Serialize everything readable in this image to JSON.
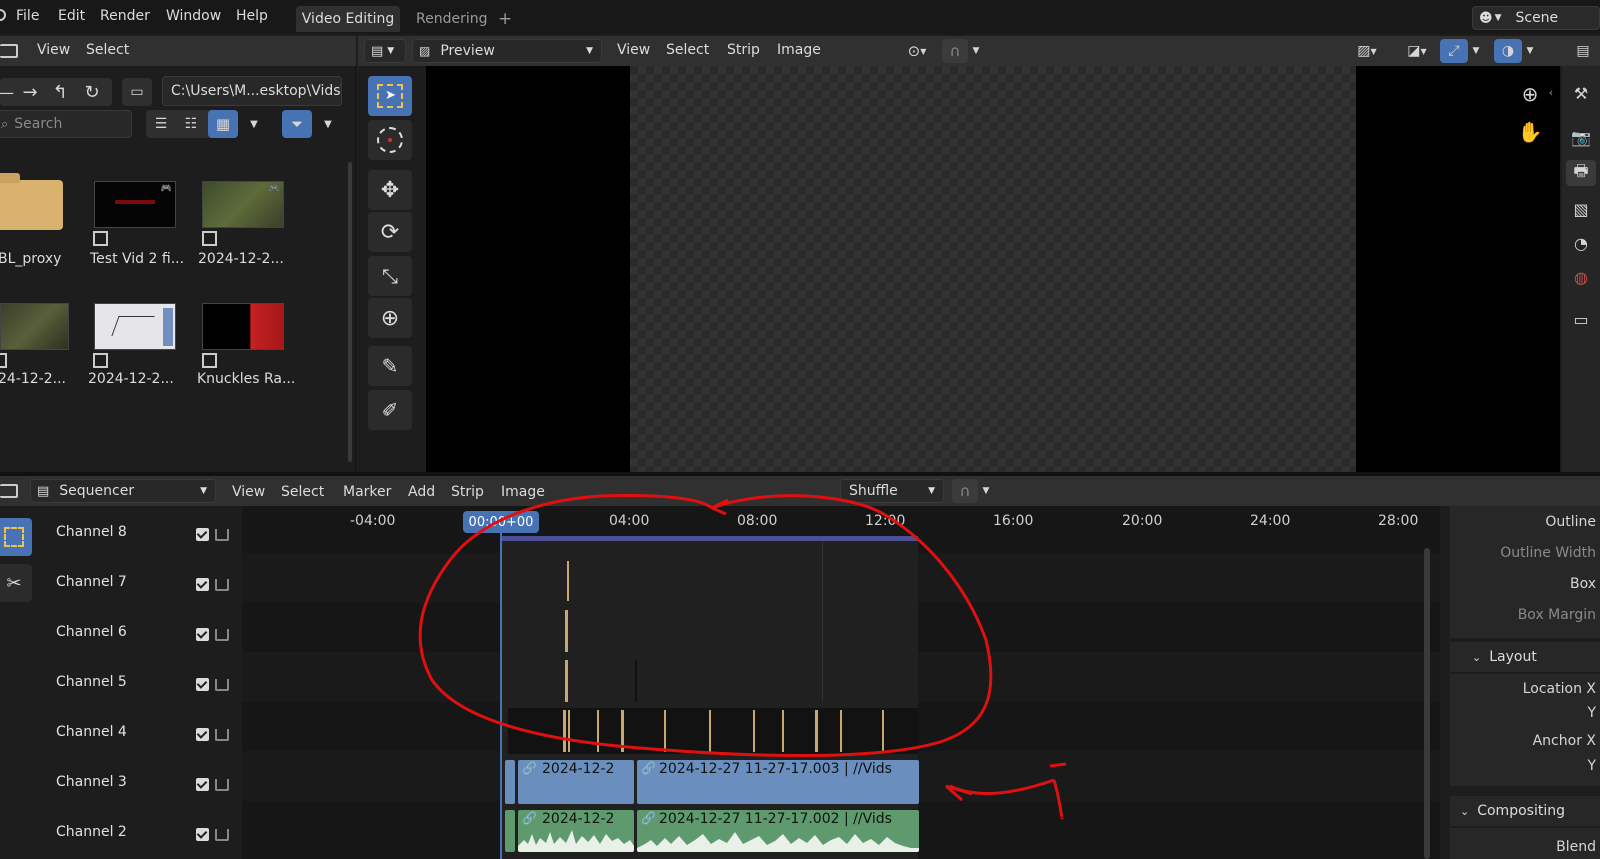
{
  "topbar": {
    "menus": [
      "File",
      "Edit",
      "Render",
      "Window",
      "Help"
    ],
    "tabs": [
      "Video Editing",
      "Rendering"
    ],
    "add_tab": "+",
    "scene": "Scene"
  },
  "file_browser": {
    "menus": [
      "View",
      "Select"
    ],
    "path": "C:\\Users\\M...esktop\\Vids\\",
    "search_placeholder": "Search",
    "files": [
      {
        "name": "BL_proxy",
        "type": "folder"
      },
      {
        "name": "Test Vid 2 fi...",
        "type": "video"
      },
      {
        "name": "2024-12-2...",
        "type": "video"
      },
      {
        "name": "24-12-2...",
        "type": "video"
      },
      {
        "name": "2024-12-2...",
        "type": "video"
      },
      {
        "name": "Knuckles Ra...",
        "type": "video"
      }
    ]
  },
  "preview": {
    "mode": "Preview",
    "menus": [
      "View",
      "Select",
      "Strip",
      "Image"
    ]
  },
  "sequencer": {
    "editor": "Sequencer",
    "menus": [
      "View",
      "Select",
      "Marker",
      "Add",
      "Strip",
      "Image"
    ],
    "snap_mode": "Shuffle",
    "current_frame": "00:00+00",
    "ruler": [
      "-04:00",
      "04:00",
      "08:00",
      "12:00",
      "16:00",
      "20:00",
      "24:00",
      "28:00"
    ],
    "channels": [
      "Channel 8",
      "Channel 7",
      "Channel 6",
      "Channel 5",
      "Channel 4",
      "Channel 3",
      "Channel 2"
    ],
    "strips": {
      "ch3_short": "2024-12-2",
      "ch3_long": "2024-12-27 11-27-17.003 | //Vids",
      "ch2_short": "2024-12-2",
      "ch2_long": "2024-12-27 11-27-17.002 | //Vids"
    }
  },
  "properties": {
    "labels": [
      "Outline",
      "Outline Width",
      "Box",
      "Box Margin"
    ],
    "layout_panel": "Layout",
    "layout_labels": [
      "Location X",
      "Y",
      "Anchor X",
      "Y"
    ],
    "compositing_panel": "Compositing",
    "compositing_labels": [
      "Blend"
    ]
  },
  "colors": {
    "strip_blue": "#6a8fbf",
    "strip_green": "#5e9a6e",
    "accent": "#4772b3",
    "annotation_red": "#e01010"
  }
}
